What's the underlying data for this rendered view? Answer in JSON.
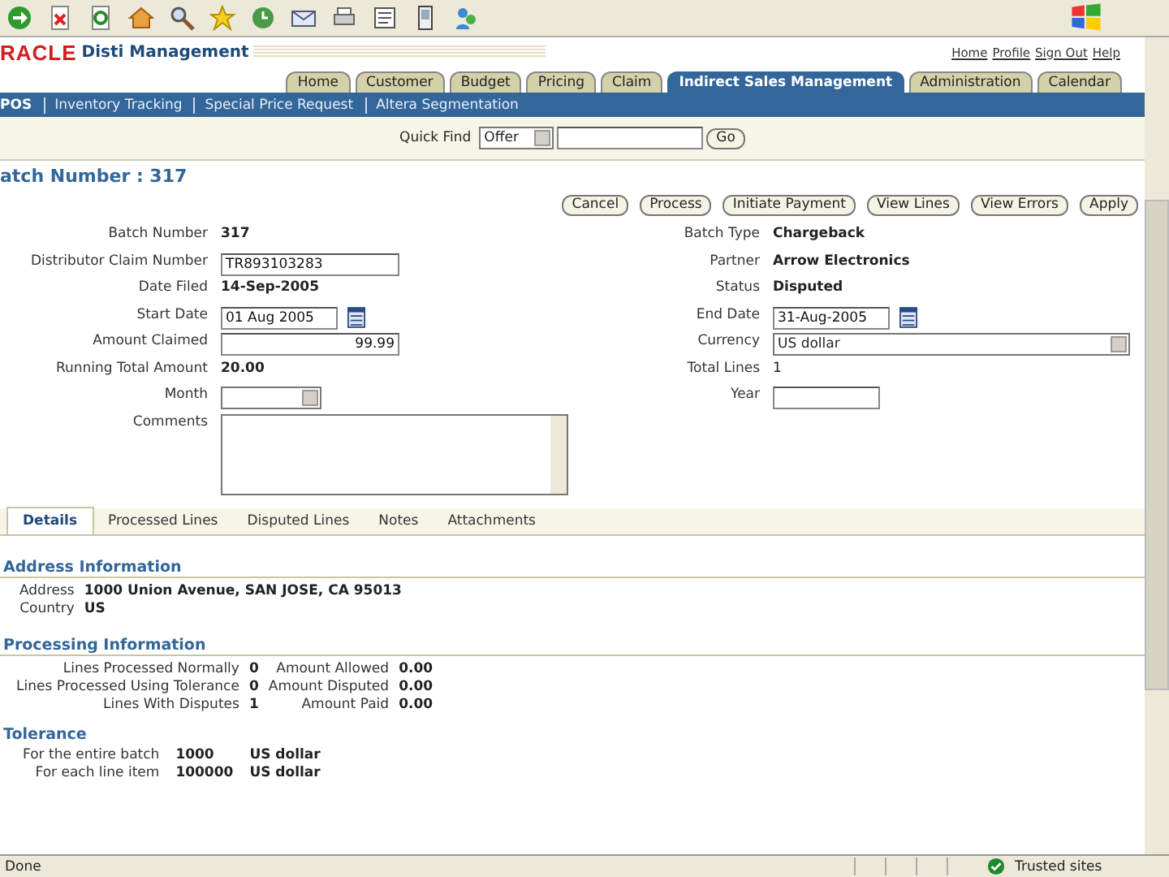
{
  "logo": "RACLE",
  "app_title": "Disti Management",
  "global_links": [
    "Home",
    "Profile",
    "Sign Out",
    "Help"
  ],
  "tabs": [
    {
      "label": "Home",
      "selected": false
    },
    {
      "label": "Customer",
      "selected": false
    },
    {
      "label": "Budget",
      "selected": false
    },
    {
      "label": "Pricing",
      "selected": false
    },
    {
      "label": "Claim",
      "selected": false
    },
    {
      "label": "Indirect Sales Management",
      "selected": true
    },
    {
      "label": "Administration",
      "selected": false
    },
    {
      "label": "Calendar",
      "selected": false
    }
  ],
  "subnav": [
    {
      "label": "POS",
      "selected": true
    },
    {
      "label": "Inventory Tracking",
      "selected": false
    },
    {
      "label": "Special Price Request",
      "selected": false
    },
    {
      "label": "Altera Segmentation",
      "selected": false
    }
  ],
  "quick_find": {
    "label": "Quick Find",
    "select": "Offer",
    "button": "Go"
  },
  "heading": "atch Number : 317",
  "buttons": [
    "Cancel",
    "Process",
    "Initiate Payment",
    "View Lines",
    "View Errors",
    "Apply"
  ],
  "left_fields": [
    {
      "label": "Batch Number",
      "kind": "text",
      "value": "317"
    },
    {
      "label": "Distributor Claim Number",
      "kind": "input",
      "value": "TR893103283"
    },
    {
      "label": "Date Filed",
      "kind": "text",
      "value": "14-Sep-2005"
    },
    {
      "label": "Start Date",
      "kind": "date",
      "value": "01 Aug 2005"
    },
    {
      "label": "Amount Claimed",
      "kind": "amount",
      "value": "99.99"
    },
    {
      "label": "Running Total Amount",
      "kind": "text",
      "value": "20.00"
    },
    {
      "label": "Month",
      "kind": "select"
    },
    {
      "label": "Comments",
      "kind": "textarea"
    }
  ],
  "right_fields": [
    {
      "label": "Batch Type",
      "kind": "text",
      "value": "Chargeback"
    },
    {
      "label": "Partner",
      "kind": "text",
      "value": "Arrow Electronics"
    },
    {
      "label": "Status",
      "kind": "text",
      "value": "Disputed"
    },
    {
      "label": "End Date",
      "kind": "date",
      "value": "31-Aug-2005"
    },
    {
      "label": "Currency",
      "kind": "wideselect",
      "value": "US dollar"
    },
    {
      "label": "Total Lines",
      "kind": "plain",
      "value": "1"
    },
    {
      "label": "Year",
      "kind": "input"
    }
  ],
  "subtabs": [
    {
      "label": "Details",
      "selected": true
    },
    {
      "label": "Processed Lines",
      "selected": false
    },
    {
      "label": "Disputed Lines",
      "selected": false
    },
    {
      "label": "Notes",
      "selected": false
    },
    {
      "label": "Attachments",
      "selected": false
    }
  ],
  "address_section": {
    "title": "Address Information",
    "rows": [
      {
        "label": "Address",
        "value": "1000 Union Avenue, SAN JOSE, CA 95013"
      },
      {
        "label": "Country",
        "value": "US"
      }
    ]
  },
  "processing_section": {
    "title": "Processing Information",
    "rows": [
      {
        "label": "Lines Processed Normally",
        "value": "0",
        "label2": "Amount Allowed",
        "value2": "0.00"
      },
      {
        "label": "Lines Processed Using Tolerance",
        "value": "0",
        "label2": "Amount Disputed",
        "value2": "0.00"
      },
      {
        "label": "Lines With Disputes",
        "value": "1",
        "label2": "Amount Paid",
        "value2": "0.00"
      }
    ]
  },
  "tolerance_section": {
    "title": "Tolerance",
    "rows": [
      {
        "label": "For the entire batch",
        "value": "1000",
        "unit": "US dollar"
      },
      {
        "label": "For each line item",
        "value": "100000",
        "unit": "US dollar"
      }
    ]
  },
  "status_bar": {
    "left": "Done",
    "zone": "Trusted sites"
  }
}
